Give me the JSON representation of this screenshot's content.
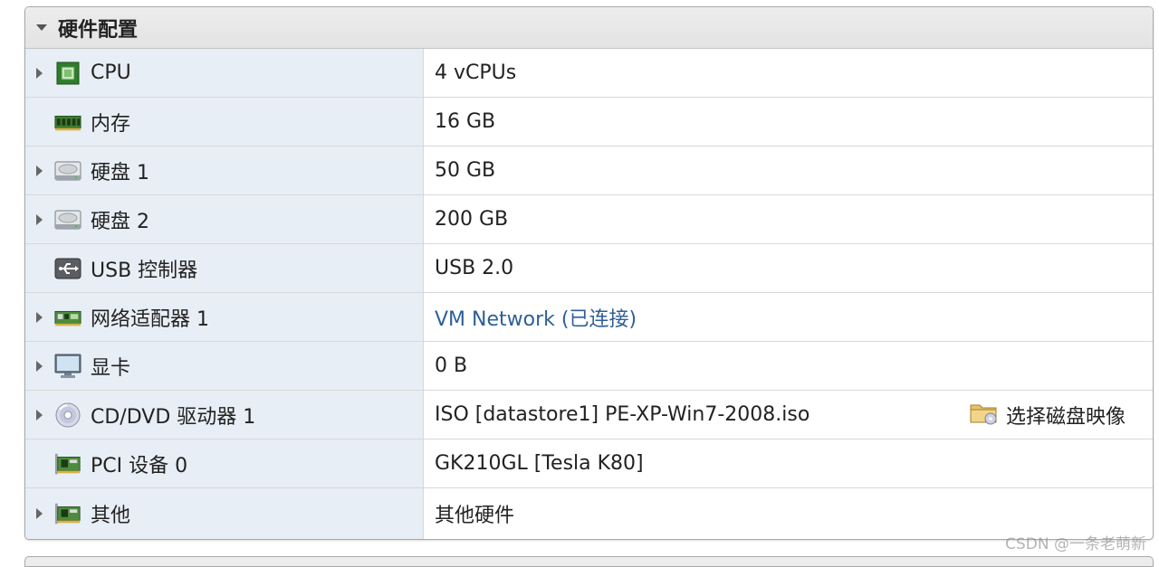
{
  "section": {
    "title": "硬件配置"
  },
  "rows": [
    {
      "label": "CPU",
      "value": "4 vCPUs",
      "icon": "cpu-icon"
    },
    {
      "label": "内存",
      "value": "16 GB",
      "icon": "memory-icon"
    },
    {
      "label": "硬盘 1",
      "value": "50 GB",
      "icon": "hard-disk-icon"
    },
    {
      "label": "硬盘 2",
      "value": "200 GB",
      "icon": "hard-disk-icon"
    },
    {
      "label": "USB 控制器",
      "value": "USB 2.0",
      "icon": "usb-icon"
    },
    {
      "label": "网络适配器 1",
      "value": "VM Network (已连接)",
      "icon": "network-adapter-icon"
    },
    {
      "label": "显卡",
      "value": "0 B",
      "icon": "monitor-icon"
    },
    {
      "label": "CD/DVD 驱动器 1",
      "value": "ISO [datastore1] PE-XP-Win7-2008.iso",
      "icon": "cd-dvd-icon",
      "action": "选择磁盘映像"
    },
    {
      "label": "PCI 设备 0",
      "value": "GK210GL [Tesla K80]",
      "icon": "pci-device-icon"
    },
    {
      "label": "其他",
      "value": "其他硬件",
      "icon": "pci-device-icon"
    }
  ],
  "colors": {
    "label_bg": "#e7eef6",
    "link": "#2f5f97"
  },
  "watermark": "CSDN @一条老萌新"
}
